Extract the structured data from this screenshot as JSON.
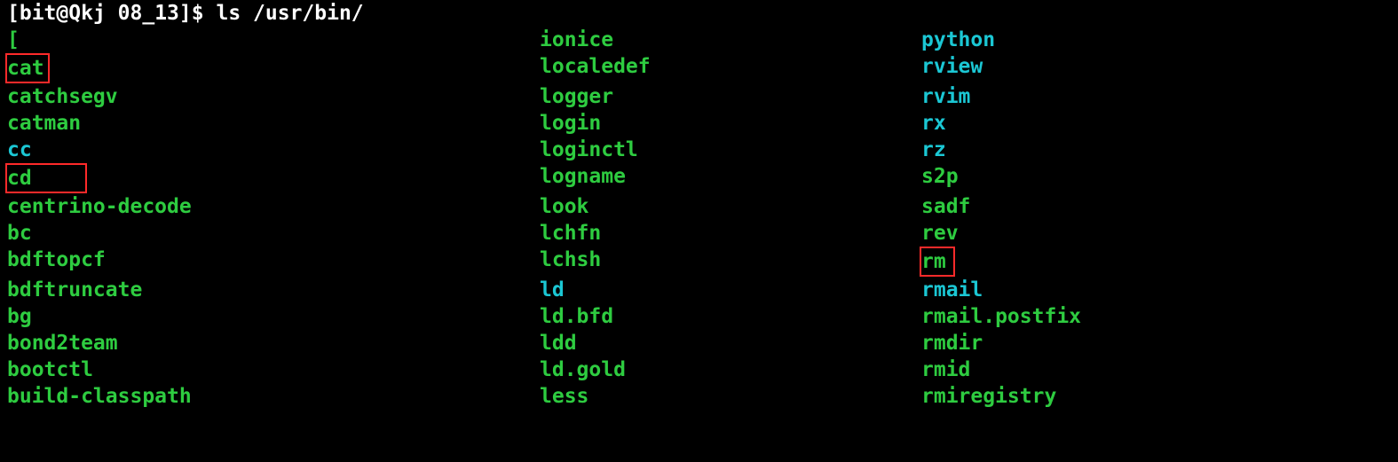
{
  "prompt": {
    "bracket_open": "[",
    "user": "bit",
    "at": "@",
    "host": "Qkj",
    "cwd": "08_13",
    "bracket_close": "]$",
    "command": "ls /usr/bin/"
  },
  "listing": [
    {
      "c1": {
        "text": "[",
        "color": "green",
        "boxed": false
      },
      "c2": {
        "text": "ionice",
        "color": "green",
        "boxed": false
      },
      "c3": {
        "text": "python",
        "color": "cyan",
        "boxed": false
      }
    },
    {
      "c1": {
        "text": "cat",
        "color": "green",
        "boxed": true,
        "boxClass": "box"
      },
      "c2": {
        "text": "localedef",
        "color": "green",
        "boxed": false
      },
      "c3": {
        "text": "rview",
        "color": "cyan",
        "boxed": false
      }
    },
    {
      "c1": {
        "text": "catchsegv",
        "color": "green",
        "boxed": false
      },
      "c2": {
        "text": "logger",
        "color": "green",
        "boxed": false
      },
      "c3": {
        "text": "rvim",
        "color": "cyan",
        "boxed": false
      }
    },
    {
      "c1": {
        "text": "catman",
        "color": "green",
        "boxed": false
      },
      "c2": {
        "text": "login",
        "color": "green",
        "boxed": false
      },
      "c3": {
        "text": "rx",
        "color": "cyan",
        "boxed": false
      }
    },
    {
      "c1": {
        "text": "cc",
        "color": "cyan",
        "boxed": false
      },
      "c2": {
        "text": "loginctl",
        "color": "green",
        "boxed": false
      },
      "c3": {
        "text": "rz",
        "color": "cyan",
        "boxed": false
      }
    },
    {
      "c1": {
        "text": "cd",
        "color": "green",
        "boxed": true,
        "boxClass": "box box-wide"
      },
      "c2": {
        "text": "logname",
        "color": "green",
        "boxed": false
      },
      "c3": {
        "text": "s2p",
        "color": "green",
        "boxed": false
      }
    },
    {
      "c1": {
        "text": "centrino-decode",
        "color": "green",
        "boxed": false
      },
      "c2": {
        "text": "look",
        "color": "green",
        "boxed": false
      },
      "c3": {
        "text": "sadf",
        "color": "green",
        "boxed": false
      }
    },
    {
      "c1": {
        "text": "bc",
        "color": "green",
        "boxed": false
      },
      "c2": {
        "text": "lchfn",
        "color": "green",
        "boxed": false
      },
      "c3": {
        "text": "rev",
        "color": "green",
        "boxed": false
      }
    },
    {
      "c1": {
        "text": "bdftopcf",
        "color": "green",
        "boxed": false
      },
      "c2": {
        "text": "lchsh",
        "color": "green",
        "boxed": false
      },
      "c3": {
        "text": "rm",
        "color": "green",
        "boxed": true,
        "boxClass": "box box-sm"
      }
    },
    {
      "c1": {
        "text": "bdftruncate",
        "color": "green",
        "boxed": false
      },
      "c2": {
        "text": "ld",
        "color": "cyan",
        "boxed": false
      },
      "c3": {
        "text": "rmail",
        "color": "cyan",
        "boxed": false
      }
    },
    {
      "c1": {
        "text": "bg",
        "color": "green",
        "boxed": false
      },
      "c2": {
        "text": "ld.bfd",
        "color": "green",
        "boxed": false
      },
      "c3": {
        "text": "rmail.postfix",
        "color": "green",
        "boxed": false
      }
    },
    {
      "c1": {
        "text": "bond2team",
        "color": "green",
        "boxed": false
      },
      "c2": {
        "text": "ldd",
        "color": "green",
        "boxed": false
      },
      "c3": {
        "text": "rmdir",
        "color": "green",
        "boxed": false
      }
    },
    {
      "c1": {
        "text": "bootctl",
        "color": "green",
        "boxed": false
      },
      "c2": {
        "text": "ld.gold",
        "color": "green",
        "boxed": false
      },
      "c3": {
        "text": "rmid",
        "color": "green",
        "boxed": false
      }
    },
    {
      "c1": {
        "text": "build-classpath",
        "color": "green",
        "boxed": false
      },
      "c2": {
        "text": "less",
        "color": "green",
        "boxed": false
      },
      "c3": {
        "text": "rmiregistry",
        "color": "green",
        "boxed": false
      }
    }
  ]
}
